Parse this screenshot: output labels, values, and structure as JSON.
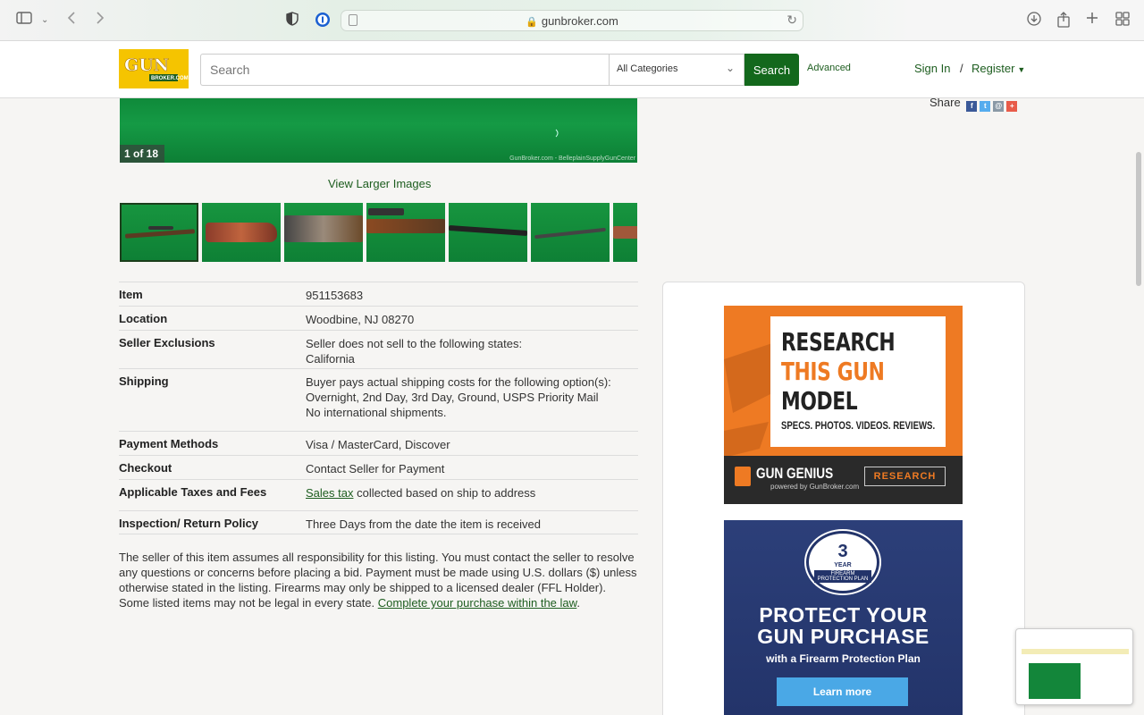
{
  "browser": {
    "url": "gunbroker.com",
    "icons": [
      "sidebar-icon",
      "chevron-down-icon",
      "back-icon",
      "forward-icon",
      "shield-icon",
      "password-icon",
      "download-icon",
      "share-icon",
      "new-tab-icon",
      "tab-overview-icon"
    ]
  },
  "header": {
    "logo_line1": "GUN",
    "logo_line2": "BROKER.COM",
    "search_placeholder": "Search",
    "category": "All Categories",
    "search_button": "Search",
    "advanced": "Advanced",
    "sign_in": "Sign In",
    "separator": "/",
    "register": "Register"
  },
  "gallery": {
    "counter": "1 of 18",
    "watermark": "GunBroker.com - BelleplainSupplyGunCenter",
    "view_larger": "View Larger Images",
    "share_label": "Share"
  },
  "details": [
    {
      "label": "Item",
      "value": [
        "951153683"
      ]
    },
    {
      "label": "Location",
      "value": [
        "Woodbine, NJ 08270"
      ]
    },
    {
      "label": "Seller Exclusions",
      "value": [
        "Seller does not sell to the following states:",
        "California"
      ]
    },
    {
      "label": "Shipping",
      "value": [
        "Buyer pays actual shipping costs for the following option(s):",
        "Overnight, 2nd Day, 3rd Day, Ground, USPS Priority Mail",
        "No international shipments."
      ]
    },
    {
      "label": "Payment Methods",
      "value": [
        "Visa / MasterCard, Discover"
      ]
    },
    {
      "label": "Checkout",
      "value": [
        "Contact Seller for Payment"
      ]
    },
    {
      "label": "Applicable Taxes and Fees",
      "link": "Sales tax",
      "value": [
        " collected based on ship to address"
      ]
    },
    {
      "label": "Inspection/ Return Policy",
      "value": [
        "Three Days from the date the item is received"
      ]
    }
  ],
  "disclaimer": {
    "text": "The seller of this item assumes all responsibility for this listing. You must contact the seller to resolve any questions or concerns before placing a bid. Payment must be made using U.S. dollars ($) unless otherwise stated in the listing. Firearms may only be shipped to a licensed dealer (FFL Holder). Some listed items may not be legal in every state. ",
    "link": "Complete your purchase within the law",
    "end": "."
  },
  "ads": {
    "research": {
      "line1": "RESEARCH",
      "line2": "THIS GUN",
      "line3": "MODEL",
      "sub": "SPECS. PHOTOS. VIDEOS. REVIEWS.",
      "brand": "GUN GENIUS",
      "powered": "powered by GunBroker.com",
      "button": "RESEARCH"
    },
    "protect": {
      "badge_num": "3",
      "badge_year": "YEAR",
      "badge_plan": "FIREARM PROTECTION PLAN",
      "line1": "PROTECT YOUR",
      "line2": "GUN PURCHASE",
      "sub": "with a Firearm Protection Plan",
      "button": "Learn more"
    }
  },
  "colors": {
    "brand_green": "#13681c",
    "link_green": "#1d5d1f",
    "logo_yellow": "#f5c400",
    "ad_orange": "#ee7a23",
    "ad_navy": "#23346a"
  }
}
